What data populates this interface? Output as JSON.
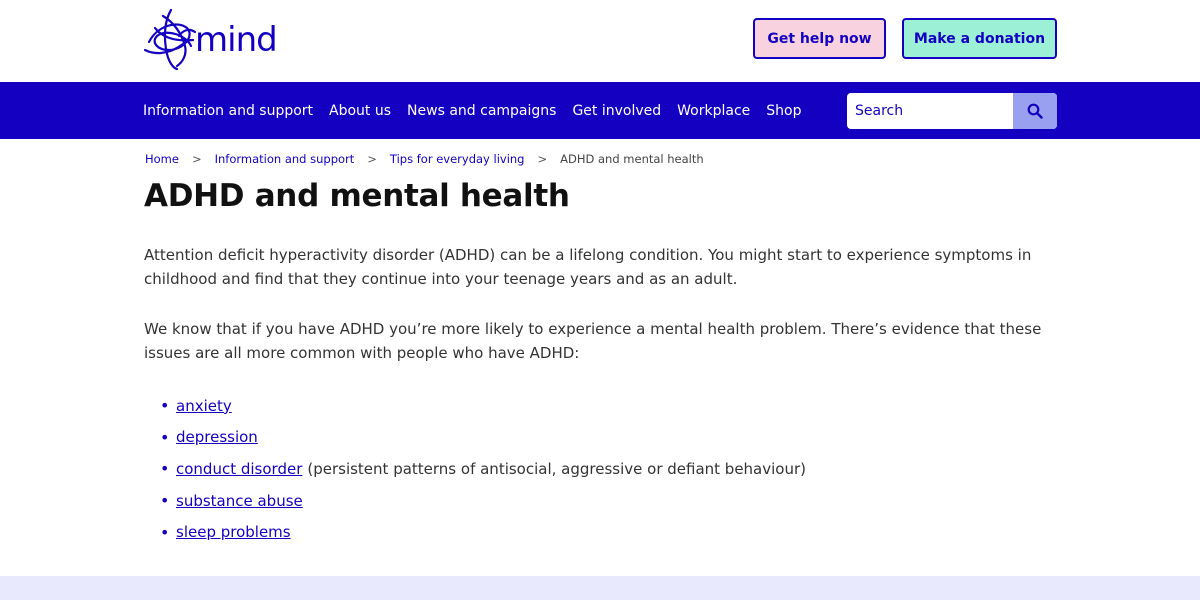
{
  "brand": {
    "name": "mind",
    "color": "#1300c1"
  },
  "header": {
    "help_label": "Get help now",
    "donate_label": "Make a donation"
  },
  "nav": {
    "items": [
      "Information and support",
      "About us",
      "News and campaigns",
      "Get involved",
      "Workplace",
      "Shop"
    ],
    "search_placeholder": "Search",
    "search_icon": "search-icon"
  },
  "breadcrumb": {
    "items": [
      "Home",
      "Information and support",
      "Tips for everyday living"
    ],
    "separator": ">",
    "current": "ADHD and mental health"
  },
  "page": {
    "title": "ADHD and mental health",
    "paragraphs": [
      "Attention deficit hyperactivity disorder (ADHD) can be a lifelong condition. You might start to experience symptoms in childhood and find that they continue into your teenage years and as an adult.",
      "We know that if you have ADHD you’re more likely to experience a mental health problem. There’s evidence that these issues are all more common with people who have ADHD:"
    ],
    "list": [
      {
        "link": "anxiety",
        "extra": ""
      },
      {
        "link": "depression",
        "extra": ""
      },
      {
        "link": "conduct disorder",
        "extra": "(persistent patterns of antisocial, aggressive or defiant behaviour)"
      },
      {
        "link": "substance abuse",
        "extra": ""
      },
      {
        "link": "sleep problems",
        "extra": ""
      }
    ]
  },
  "colors": {
    "nav_bg": "#1300c1",
    "help_bg": "#f9d2df",
    "donate_bg": "#9cf0d6",
    "search_btn_bg": "#9aa0f0",
    "footer_band": "#e8e9fc"
  }
}
